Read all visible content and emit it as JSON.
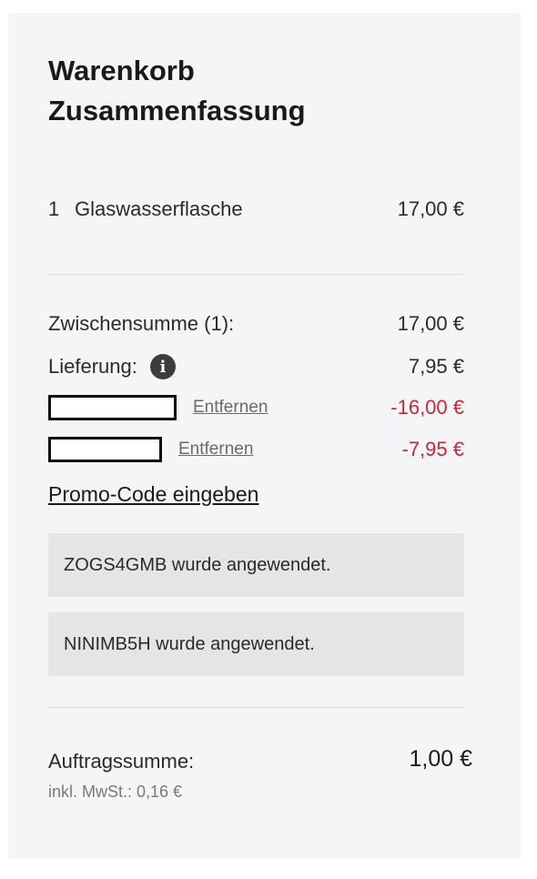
{
  "summary": {
    "title_line1": "Warenkorb",
    "title_line2": "Zusammenfassung"
  },
  "items": [
    {
      "qty": "1",
      "name": "Glaswasserflasche",
      "price": "17,00 €"
    }
  ],
  "totals": {
    "subtotal_label": "Zwischensumme (1):",
    "subtotal_value": "17,00 €",
    "delivery_label": "Lieferung:",
    "delivery_value": "7,95 €",
    "info_icon": "info-icon"
  },
  "discounts": [
    {
      "remove_label": "Entfernen",
      "amount": "-16,00 €"
    },
    {
      "remove_label": "Entfernen",
      "amount": "-7,95 €"
    }
  ],
  "promo": {
    "link_label": "Promo-Code eingeben"
  },
  "notices": [
    "ZOGS4GMB wurde angewendet.",
    "NINIMB5H wurde angewendet."
  ],
  "order": {
    "total_label": "Auftragssumme:",
    "total_value": "1,00 €",
    "vat_text": "inkl. MwSt.: 0,16 €"
  },
  "colors": {
    "panel_bg": "#f4f5f7",
    "discount_red": "#c8283a",
    "notice_bg": "#e4e5e7"
  }
}
